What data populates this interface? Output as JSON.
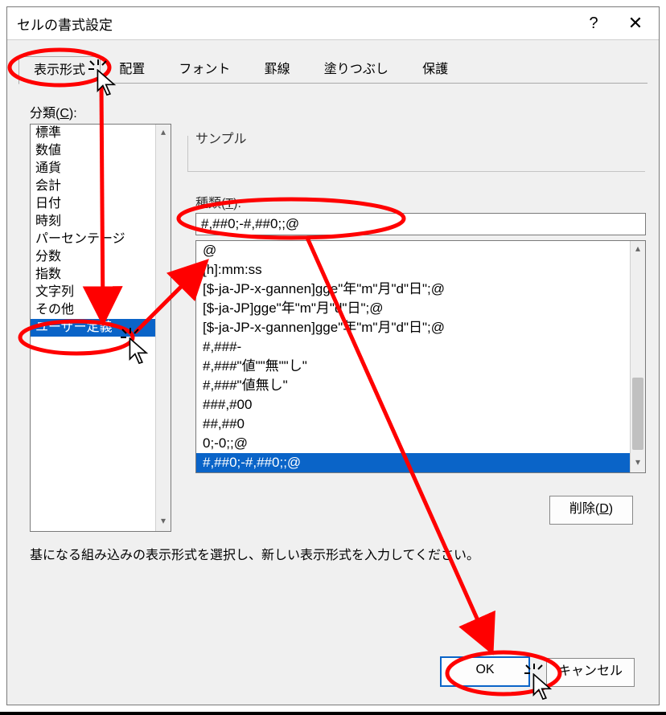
{
  "window": {
    "title": "セルの書式設定",
    "help": "?",
    "close": "✕"
  },
  "tabs": [
    "表示形式",
    "配置",
    "フォント",
    "罫線",
    "塗りつぶし",
    "保護"
  ],
  "activeTab": 0,
  "categoryLabelPrefix": "分類(",
  "categoryLabelKey": "C",
  "categoryLabelSuffix": "):",
  "categories": [
    "標準",
    "数値",
    "通貨",
    "会計",
    "日付",
    "時刻",
    "パーセンテージ",
    "分数",
    "指数",
    "文字列",
    "その他",
    "ユーザー定義"
  ],
  "selectedCategoryIndex": 11,
  "sampleLabel": "サンプル",
  "typeLabelPrefix": "種類(",
  "typeLabelKey": "T",
  "typeLabelSuffix": "):",
  "typeValue": "#,##0;-#,##0;;@",
  "typeList": [
    "@",
    "[h]:mm:ss",
    "[$-ja-JP-x-gannen]gge\"年\"m\"月\"d\"日\";@",
    "[$-ja-JP]gge\"年\"m\"月\"d\"日\";@",
    "[$-ja-JP-x-gannen]gge\"年\"m\"月\"d\"日\";@",
    "#,###-",
    "#,###\"値\"\"無\"\"し\"",
    "#,###\"値無し\"",
    "###,#00",
    "##,##0",
    "0;-0;;@",
    "#,##0;-#,##0;;@"
  ],
  "selectedTypeIndex": 11,
  "deletePrefix": "削除(",
  "deleteKey": "D",
  "deleteSuffix": ")",
  "hint": "基になる組み込みの表示形式を選択し、新しい表示形式を入力してください。",
  "ok": "OK",
  "cancel": "キャンセル"
}
